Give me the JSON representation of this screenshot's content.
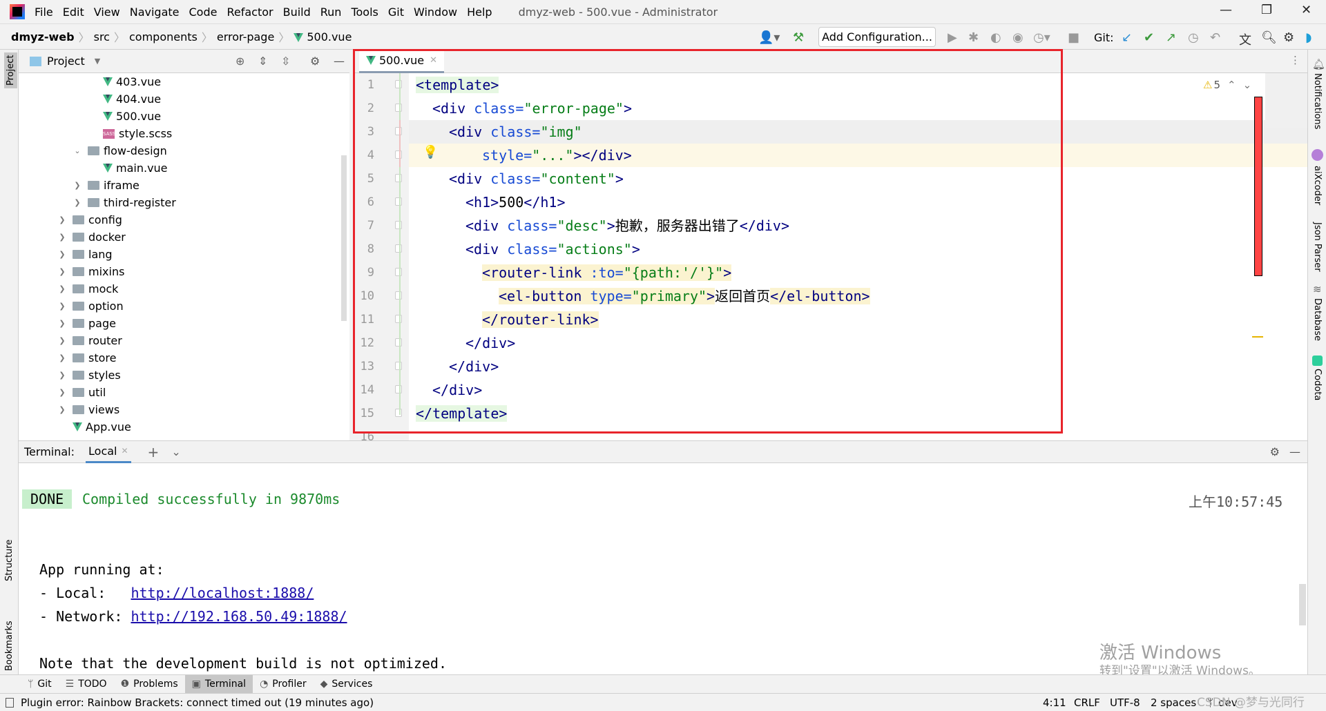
{
  "menubar": {
    "items": [
      "File",
      "Edit",
      "View",
      "Navigate",
      "Code",
      "Refactor",
      "Build",
      "Run",
      "Tools",
      "Git",
      "Window",
      "Help"
    ],
    "title": "dmyz-web - 500.vue - Administrator"
  },
  "breadcrumb": [
    "dmyz-web",
    "src",
    "components",
    "error-page",
    "500.vue"
  ],
  "toolbar": {
    "add_config": "Add Configuration...",
    "git_label": "Git:"
  },
  "project": {
    "title": "Project",
    "tree": [
      {
        "label": "403.vue",
        "type": "vue",
        "depth": 5
      },
      {
        "label": "404.vue",
        "type": "vue",
        "depth": 5
      },
      {
        "label": "500.vue",
        "type": "vue",
        "depth": 5
      },
      {
        "label": "style.scss",
        "type": "sass",
        "depth": 5
      },
      {
        "label": "flow-design",
        "type": "folder-open",
        "depth": 4
      },
      {
        "label": "main.vue",
        "type": "vue",
        "depth": 5
      },
      {
        "label": "iframe",
        "type": "folder",
        "depth": 4
      },
      {
        "label": "third-register",
        "type": "folder",
        "depth": 4
      },
      {
        "label": "config",
        "type": "folder",
        "depth": 3
      },
      {
        "label": "docker",
        "type": "folder",
        "depth": 3
      },
      {
        "label": "lang",
        "type": "folder",
        "depth": 3
      },
      {
        "label": "mixins",
        "type": "folder",
        "depth": 3
      },
      {
        "label": "mock",
        "type": "folder",
        "depth": 3
      },
      {
        "label": "option",
        "type": "folder",
        "depth": 3
      },
      {
        "label": "page",
        "type": "folder",
        "depth": 3
      },
      {
        "label": "router",
        "type": "folder",
        "depth": 3
      },
      {
        "label": "store",
        "type": "folder",
        "depth": 3
      },
      {
        "label": "styles",
        "type": "folder",
        "depth": 3
      },
      {
        "label": "util",
        "type": "folder",
        "depth": 3
      },
      {
        "label": "views",
        "type": "folder",
        "depth": 3
      },
      {
        "label": "App.vue",
        "type": "vue",
        "depth": 3
      }
    ]
  },
  "editor": {
    "tab": "500.vue",
    "warnings": "5",
    "lines": [
      {
        "n": "1",
        "indent": 0,
        "tokens": [
          [
            "<",
            "tag",
            "bg"
          ],
          [
            "template",
            "tag",
            "bg"
          ],
          [
            ">",
            "tag",
            "bg"
          ]
        ]
      },
      {
        "n": "2",
        "indent": 1,
        "tokens": [
          [
            "<div ",
            "tag"
          ],
          [
            "class=",
            "attr"
          ],
          [
            "\"error-page\"",
            "val"
          ],
          [
            ">",
            "tag"
          ]
        ]
      },
      {
        "n": "3",
        "indent": 2,
        "tokens": [
          [
            "<div ",
            "tag"
          ],
          [
            "class=",
            "attr"
          ],
          [
            "\"img\"",
            "val"
          ]
        ]
      },
      {
        "n": "4",
        "indent": 4,
        "tokens": [
          [
            "style=",
            "attr"
          ],
          [
            "\"...\"",
            "val"
          ],
          [
            "></div>",
            "tag"
          ]
        ]
      },
      {
        "n": "5",
        "indent": 2,
        "tokens": [
          [
            "<div ",
            "tag"
          ],
          [
            "class=",
            "attr"
          ],
          [
            "\"content\"",
            "val"
          ],
          [
            ">",
            "tag"
          ]
        ]
      },
      {
        "n": "6",
        "indent": 3,
        "tokens": [
          [
            "<h1>",
            "tag"
          ],
          [
            "500",
            "txt"
          ],
          [
            "</h1>",
            "tag"
          ]
        ]
      },
      {
        "n": "7",
        "indent": 3,
        "tokens": [
          [
            "<div ",
            "tag"
          ],
          [
            "class=",
            "attr"
          ],
          [
            "\"desc\"",
            "val"
          ],
          [
            ">",
            "tag"
          ],
          [
            "抱歉，服务器出错了",
            "txt"
          ],
          [
            "</div>",
            "tag"
          ]
        ]
      },
      {
        "n": "8",
        "indent": 3,
        "tokens": [
          [
            "<div ",
            "tag"
          ],
          [
            "class=",
            "attr"
          ],
          [
            "\"actions\"",
            "val"
          ],
          [
            ">",
            "tag"
          ]
        ]
      },
      {
        "n": "9",
        "indent": 4,
        "tokens": [
          [
            "<router-link ",
            "tag",
            "bg2"
          ],
          [
            ":to=",
            "attr",
            "bg2"
          ],
          [
            "\"{path:'/'}\"",
            "val",
            "bg2"
          ],
          [
            ">",
            "tag",
            "bg2"
          ]
        ]
      },
      {
        "n": "10",
        "indent": 5,
        "tokens": [
          [
            "<el-button ",
            "tag",
            "bg2"
          ],
          [
            "type=",
            "attr",
            "bg2"
          ],
          [
            "\"primary\"",
            "val",
            "bg2"
          ],
          [
            ">",
            "tag",
            "bg2"
          ],
          [
            "返回首页",
            "txt"
          ],
          [
            "</el-button>",
            "tag",
            "bg2"
          ]
        ]
      },
      {
        "n": "11",
        "indent": 4,
        "tokens": [
          [
            "</router-link>",
            "tag",
            "bg2"
          ]
        ]
      },
      {
        "n": "12",
        "indent": 3,
        "tokens": [
          [
            "</div>",
            "tag"
          ]
        ]
      },
      {
        "n": "13",
        "indent": 2,
        "tokens": [
          [
            "</div>",
            "tag"
          ]
        ]
      },
      {
        "n": "14",
        "indent": 1,
        "tokens": [
          [
            "</div>",
            "tag"
          ]
        ]
      },
      {
        "n": "15",
        "indent": 0,
        "tokens": [
          [
            "</template>",
            "tag",
            "bg"
          ]
        ]
      },
      {
        "n": "16",
        "indent": 0,
        "tokens": []
      }
    ]
  },
  "terminal": {
    "label": "Terminal:",
    "tab": "Local",
    "done": "DONE",
    "compiled": "Compiled successfully in 9870ms",
    "time": "上午10:57:45",
    "app_running": "App running at:",
    "local_label": "- Local:   ",
    "local_url": "http://localhost:1888/",
    "network_label": "- Network: ",
    "network_url": "http://192.168.50.49:1888/",
    "note": "Note that the development build is not optimized."
  },
  "bottom_tools": [
    "Git",
    "TODO",
    "Problems",
    "Terminal",
    "Profiler",
    "Services"
  ],
  "active_bottom_tool": "Terminal",
  "status": {
    "message": "Plugin error: Rainbow Brackets: connect timed out (19 minutes ago)",
    "position": "4:11",
    "line_sep": "CRLF",
    "encoding": "UTF-8",
    "indent": "2 spaces",
    "branch": "dev"
  },
  "left_strip": [
    "Project",
    "Structure",
    "Bookmarks"
  ],
  "right_strip": [
    "Notifications",
    "aiXcoder",
    "Json Parser",
    "Database",
    "Codota"
  ],
  "watermarks": {
    "activate_title": "激活 Windows",
    "activate_sub": "转到\"设置\"以激活 Windows。",
    "csdn": "CSDN @梦与光同行"
  }
}
